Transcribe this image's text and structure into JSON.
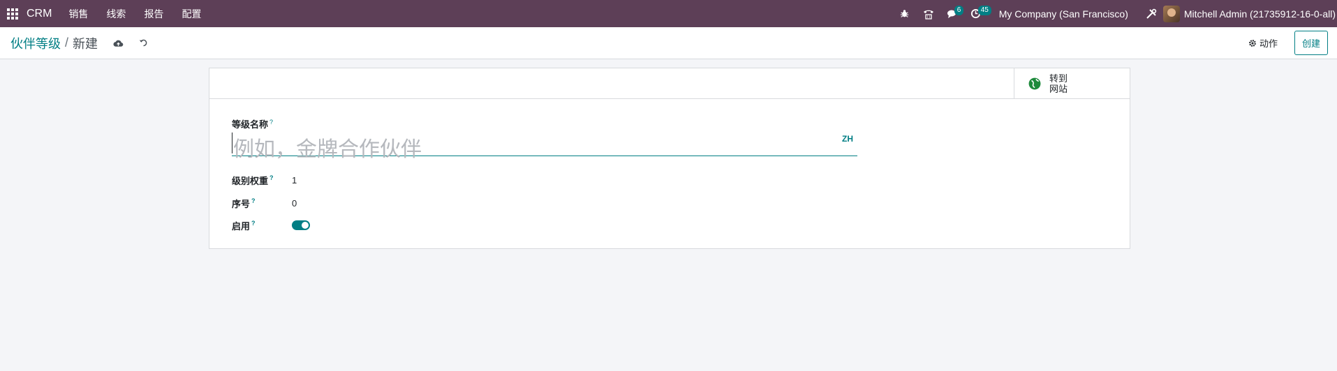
{
  "navbar": {
    "brand": "CRM",
    "menu": [
      "销售",
      "线索",
      "报告",
      "配置"
    ],
    "messages_count": "6",
    "activities_count": "45",
    "company": "My Company (San Francisco)",
    "user": "Mitchell Admin (21735912-16-0-all)"
  },
  "control": {
    "breadcrumb_parent": "伙伴等级",
    "breadcrumb_sep": "/",
    "breadcrumb_current": "新建",
    "action_label": "动作",
    "create_label": "创建"
  },
  "form": {
    "website_button": {
      "line1": "转到",
      "line2": "网站"
    },
    "name_label": "等级名称",
    "name_placeholder": "例如，金牌合作伙伴",
    "lang": "ZH",
    "weight_label": "级别权重",
    "weight_value": "1",
    "sequence_label": "序号",
    "sequence_value": "0",
    "active_label": "启用",
    "active": true,
    "tip_mark": "?"
  },
  "colors": {
    "navbar": "#5d3f57",
    "accent": "#017e84"
  }
}
